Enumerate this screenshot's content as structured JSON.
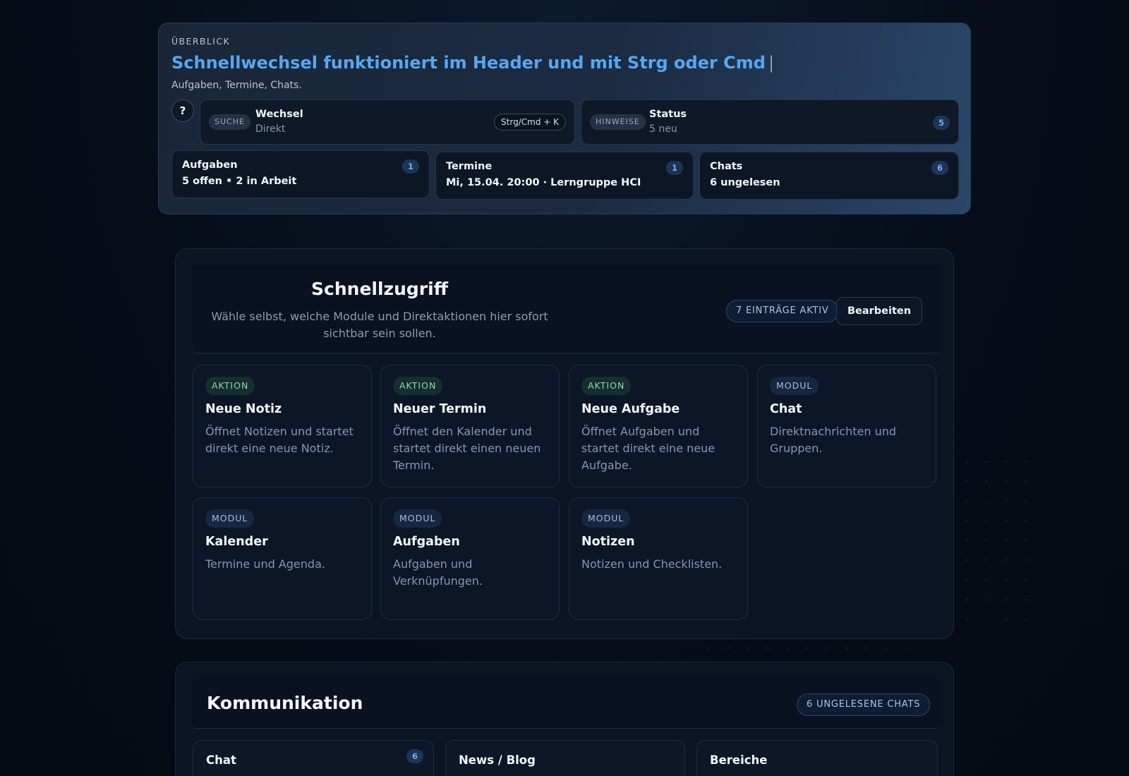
{
  "overview": {
    "eyebrow": "ÜBERBLICK",
    "title": "Schnellwechsel funktioniert im Header und mit Strg oder Cmd",
    "caret": "|",
    "subtitle": "Aufgaben, Termine, Chats.",
    "help_label": "?",
    "search": {
      "pill": "SUCHE",
      "title": "Wechsel",
      "sub": "Direkt",
      "shortcut": "Strg/Cmd + K"
    },
    "notice": {
      "pill": "HINWEISE",
      "title": "Status",
      "sub": "5 neu",
      "count": "5"
    },
    "stats": [
      {
        "title": "Aufgaben",
        "value": "5 offen • 2 in Arbeit",
        "count": "1"
      },
      {
        "title": "Termine",
        "value": "Mi, 15.04. 20:00 · Lerngruppe HCI",
        "count": "1"
      },
      {
        "title": "Chats",
        "value": "6 ungelesen",
        "count": "6"
      }
    ]
  },
  "quick": {
    "title": "Schnellzugriff",
    "subtitle": "Wähle selbst, welche Module und Direktaktionen hier sofort sichtbar sein sollen.",
    "active_pill": "7 EINTRÄGE AKTIV",
    "edit_label": "Bearbeiten",
    "tiles": [
      {
        "tag": "AKTION",
        "title": "Neue Notiz",
        "desc": "Öffnet Notizen und startet direkt eine neue Notiz."
      },
      {
        "tag": "AKTION",
        "title": "Neuer Termin",
        "desc": "Öffnet den Kalender und startet direkt einen neuen Termin."
      },
      {
        "tag": "AKTION",
        "title": "Neue Aufgabe",
        "desc": "Öffnet Aufgaben und startet direkt eine neue Aufgabe."
      },
      {
        "tag": "MODUL",
        "title": "Chat",
        "desc": "Direktnachrichten und Gruppen."
      },
      {
        "tag": "MODUL",
        "title": "Kalender",
        "desc": "Termine und Agenda."
      },
      {
        "tag": "MODUL",
        "title": "Aufgaben",
        "desc": "Aufgaben und Verknüpfungen."
      },
      {
        "tag": "MODUL",
        "title": "Notizen",
        "desc": "Notizen und Checklisten."
      }
    ]
  },
  "comm": {
    "title": "Kommunikation",
    "unread_pill": "6 UNGELESENE CHATS",
    "cards": [
      {
        "title": "Chat",
        "count": "6"
      },
      {
        "title": "News / Blog"
      },
      {
        "title": "Bereiche"
      }
    ]
  },
  "colors": {
    "accent": "#57a6f2",
    "action_tag": "#8fd4b5",
    "module_tag": "#a3bde0"
  }
}
